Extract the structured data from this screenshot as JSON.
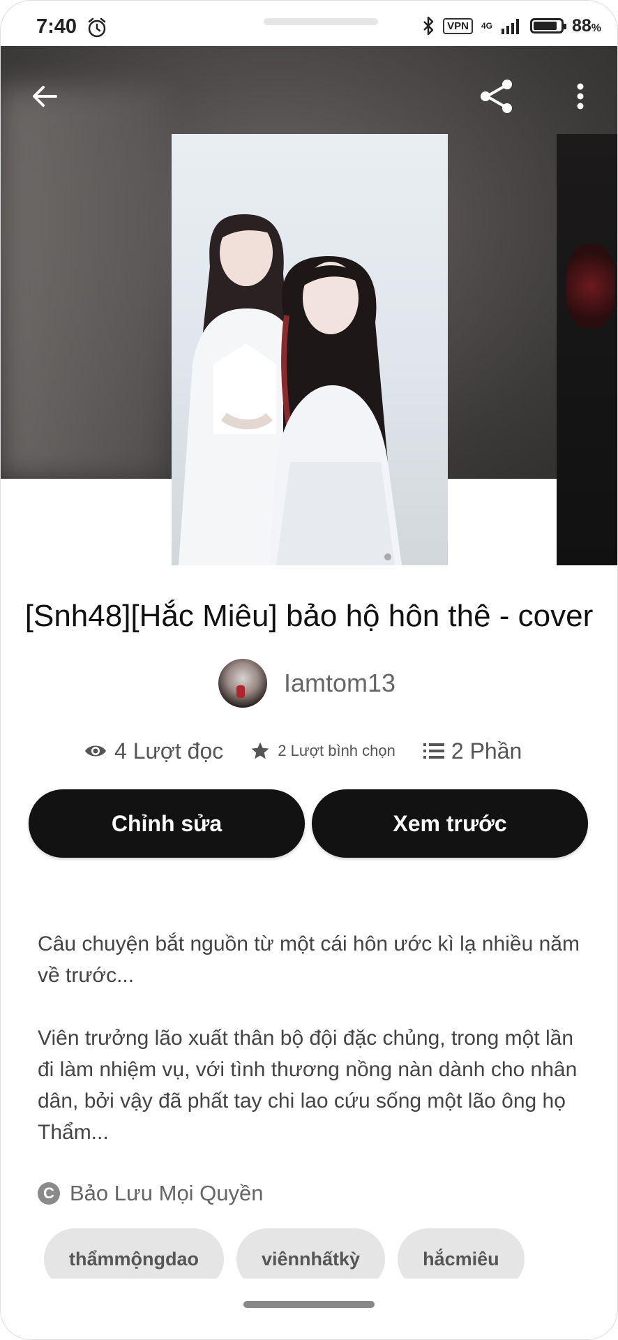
{
  "status_bar": {
    "time": "7:40",
    "vpn": "VPN",
    "network": "4G",
    "battery_pct": "88",
    "battery_suffix": "%",
    "battery_level": 0.88
  },
  "header": {
    "back_icon": "arrow-left-icon",
    "share_icon": "share-icon",
    "more_icon": "more-vertical-icon"
  },
  "story": {
    "title": "[Snh48][Hắc Miêu] bảo hộ hôn thê - cover",
    "author": "Iamtom13",
    "stats": {
      "reads": "4 Lượt đọc",
      "votes": "2 Lượt bình chọn",
      "parts": "2 Phần"
    },
    "description": [
      "Câu chuyện bắt nguồn từ một cái hôn ước kì lạ nhiều năm về trước...",
      "Viên trưởng lão xuất thân bộ đội đặc chủng, trong một lần đi làm nhiệm vụ, với tình thương nồng nàn dành cho nhân dân, bởi vậy đã phất tay chi lao cứu sống một lão ông họ Thẩm..."
    ],
    "copyright": "Bảo Lưu Mọi Quyền",
    "tags": [
      "thẩmmộngdao",
      "viênnhấtkỳ",
      "hắcmiêu"
    ]
  },
  "actions": {
    "edit": "Chỉnh sửa",
    "preview": "Xem trước"
  },
  "colors": {
    "button_bg": "#121212",
    "tag_bg": "#e5e5e5",
    "hero_bg": "#4a4746"
  }
}
